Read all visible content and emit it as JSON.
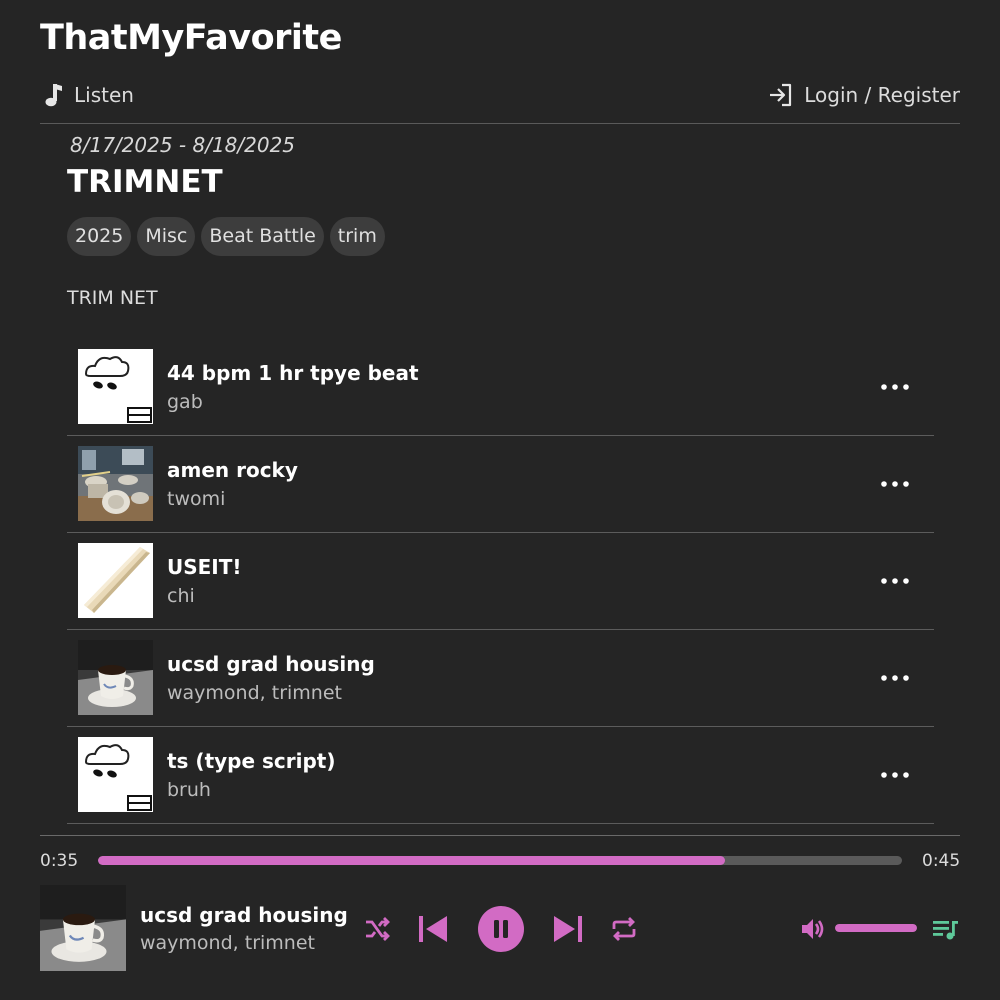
{
  "app": {
    "title": "ThatMyFavorite"
  },
  "nav": {
    "listen_label": "Listen",
    "login_label": "Login / Register"
  },
  "playlist": {
    "date_range": "8/17/2025 - 8/18/2025",
    "title": "TRIMNET",
    "tags": [
      "2025",
      "Misc",
      "Beat Battle",
      "trim"
    ],
    "description": "TRIM NET",
    "tracks": [
      {
        "title": "44 bpm 1 hr tpye beat",
        "artist": "gab",
        "art": "cloud-art"
      },
      {
        "title": "amen rocky",
        "artist": "twomi",
        "art": "drum-kit-art"
      },
      {
        "title": "USEIT!",
        "artist": "chi",
        "art": "trim-molding-art"
      },
      {
        "title": "ucsd grad housing",
        "artist": "waymond, trimnet",
        "art": "coffee-cup-art"
      },
      {
        "title": "ts (type script)",
        "artist": "bruh",
        "art": "cloud-art"
      }
    ]
  },
  "player": {
    "elapsed": "0:35",
    "duration": "0:45",
    "progress": 0.78,
    "volume": 1.0,
    "now_playing": {
      "title": "ucsd grad housing",
      "artist": "waymond, trimnet"
    },
    "state": "playing"
  },
  "icons": {
    "listen": "music-note-icon",
    "login": "login-arrow-icon",
    "more": "more-horizontal-icon",
    "shuffle": "shuffle-icon",
    "previous": "skip-previous-icon",
    "pause": "pause-icon",
    "next": "skip-next-icon",
    "repeat": "repeat-icon",
    "volume": "volume-icon",
    "queue": "queue-music-icon"
  },
  "colors": {
    "background": "#252525",
    "accent": "#d26bc4",
    "queue_icon": "#5ec99a",
    "divider": "#5c5c5c"
  }
}
